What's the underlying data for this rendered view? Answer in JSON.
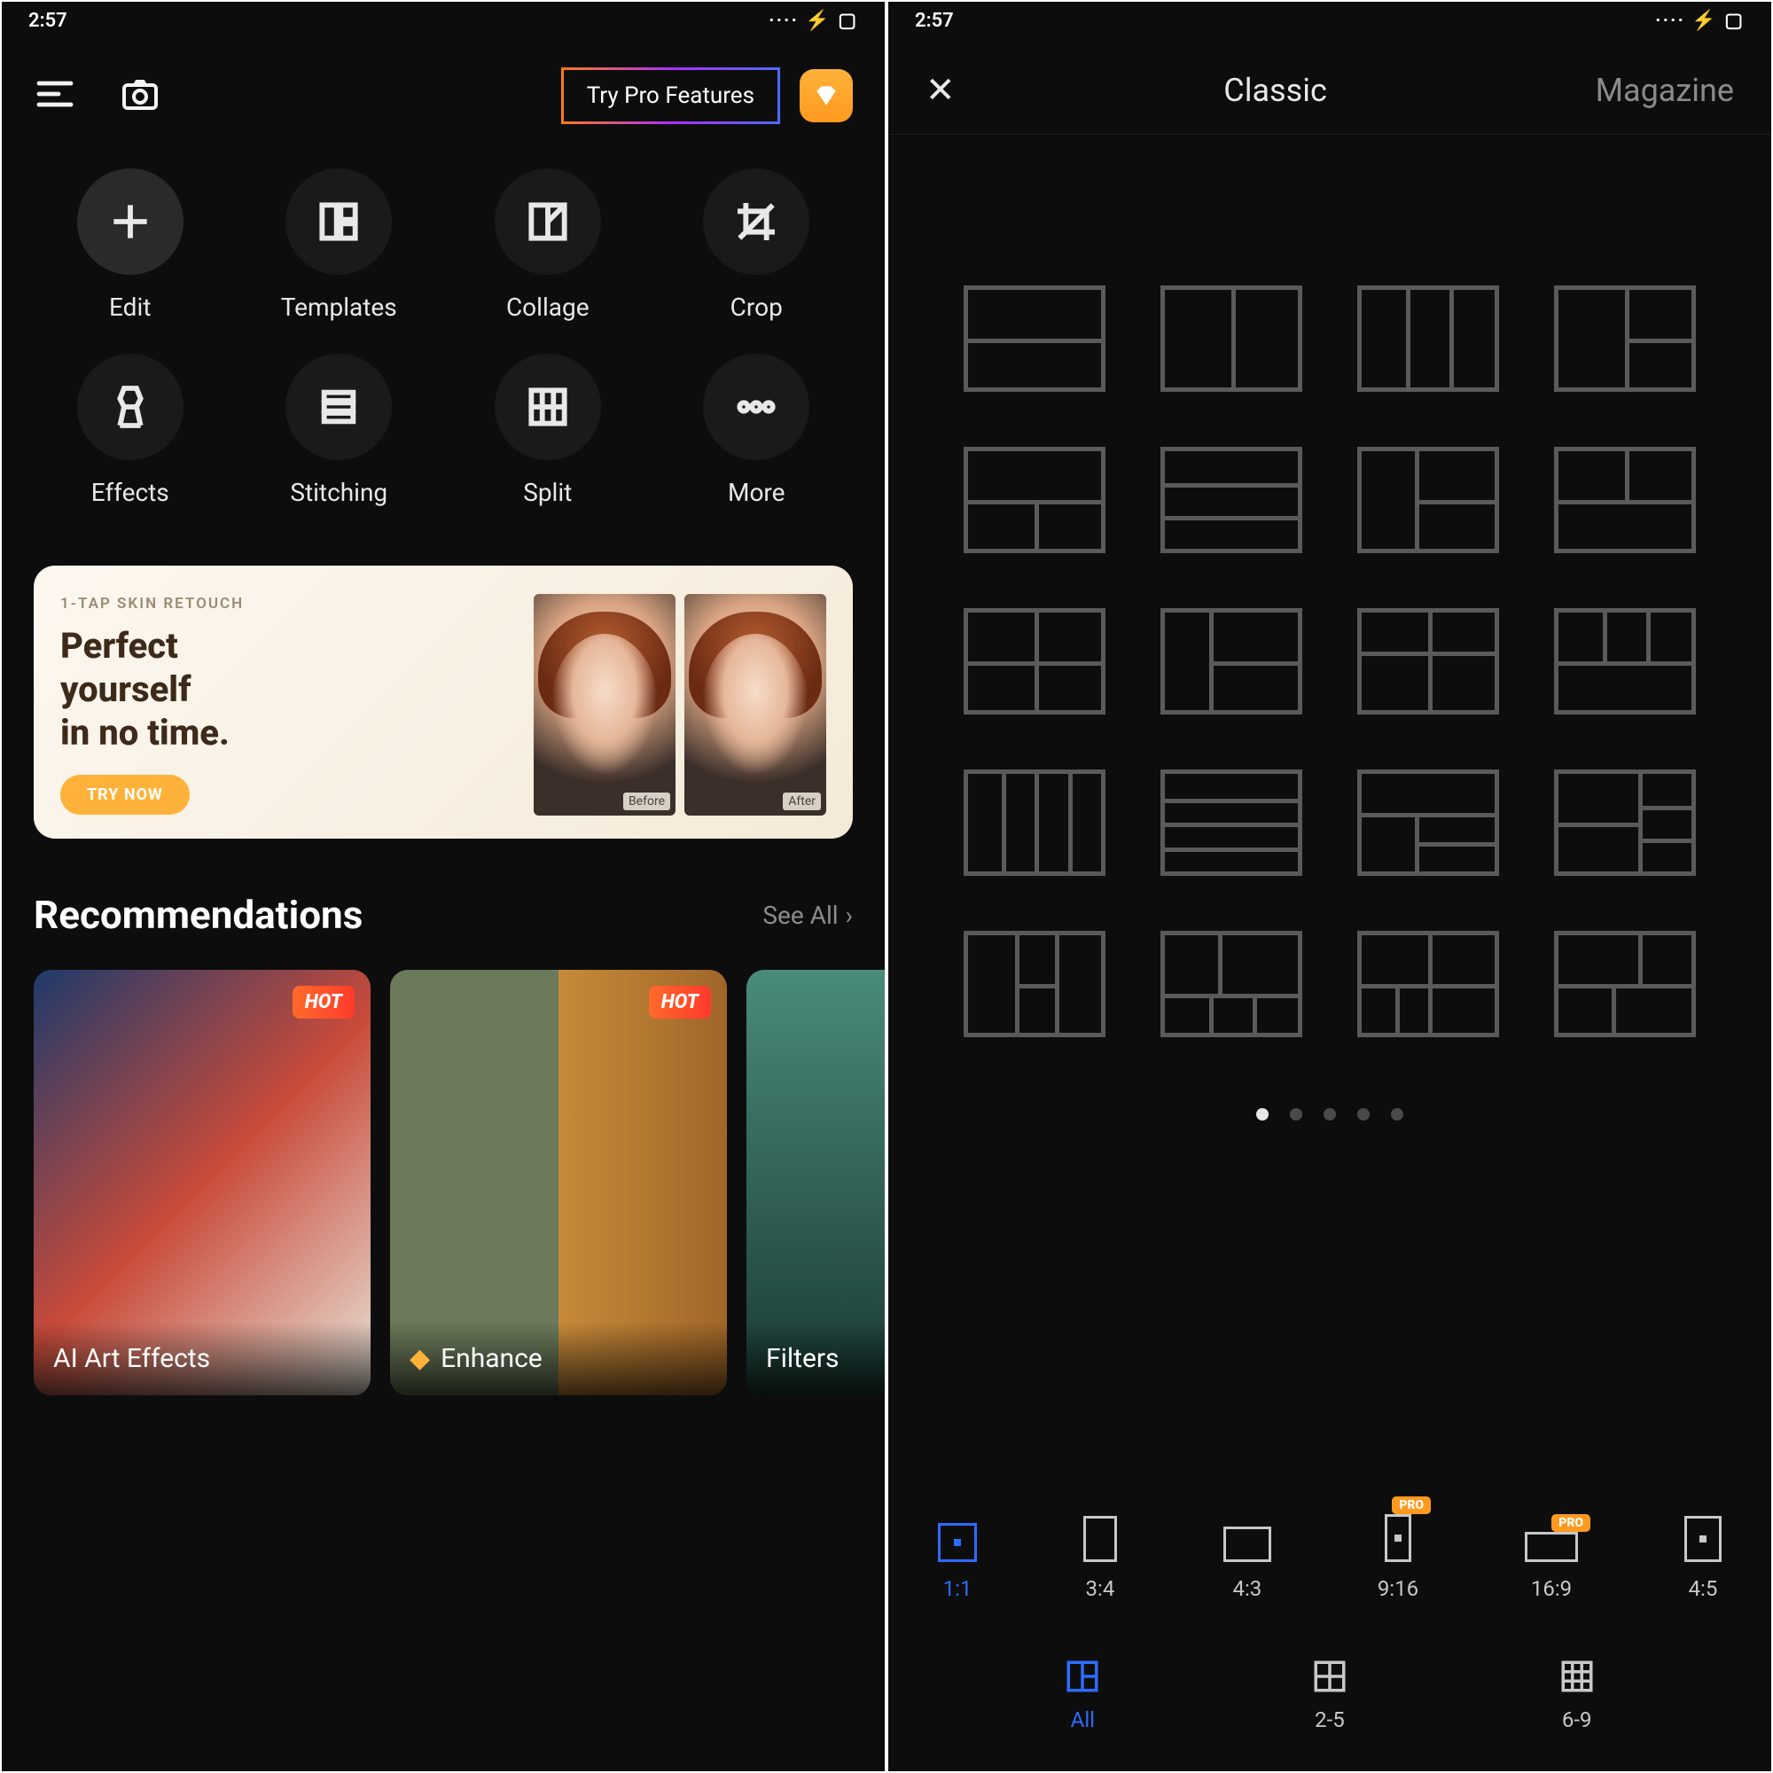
{
  "status": {
    "time": "2:57",
    "right": "···· ⚡ ▢"
  },
  "left": {
    "topbar": {
      "try_pro": "Try Pro Features"
    },
    "tools": [
      {
        "label": "Edit"
      },
      {
        "label": "Templates"
      },
      {
        "label": "Collage"
      },
      {
        "label": "Crop"
      },
      {
        "label": "Effects"
      },
      {
        "label": "Stitching"
      },
      {
        "label": "Split"
      },
      {
        "label": "More"
      }
    ],
    "promo": {
      "tag": "1-TAP SKIN RETOUCH",
      "title_1": "Perfect",
      "title_2": "yourself",
      "title_3": "in no time.",
      "cta": "TRY NOW",
      "before": "Before",
      "after": "After"
    },
    "recs": {
      "heading": "Recommendations",
      "see_all": "See All",
      "hot": "HOT",
      "cards": [
        {
          "label": "AI Art Effects"
        },
        {
          "label": "Enhance"
        },
        {
          "label": "Filters"
        }
      ]
    }
  },
  "right": {
    "topbar": {
      "tab_classic": "Classic",
      "tab_magazine": "Magazine"
    },
    "page_dots": {
      "count": 5,
      "active": 0
    },
    "ratios": [
      {
        "label": "1:1",
        "w": 44,
        "h": 44,
        "active": true,
        "pro": false,
        "dot": true
      },
      {
        "label": "3:4",
        "w": 38,
        "h": 52,
        "active": false,
        "pro": false,
        "dot": false
      },
      {
        "label": "4:3",
        "w": 54,
        "h": 40,
        "active": false,
        "pro": false,
        "dot": false
      },
      {
        "label": "9:16",
        "w": 30,
        "h": 54,
        "active": false,
        "pro": true,
        "dot": true
      },
      {
        "label": "16:9",
        "w": 60,
        "h": 34,
        "active": false,
        "pro": true,
        "dot": false
      },
      {
        "label": "4:5",
        "w": 42,
        "h": 52,
        "active": false,
        "pro": false,
        "dot": true
      }
    ],
    "pro_label": "PRO",
    "bottom_tabs": [
      {
        "label": "All",
        "active": true
      },
      {
        "label": "2-5",
        "active": false
      },
      {
        "label": "6-9",
        "active": false
      }
    ]
  }
}
